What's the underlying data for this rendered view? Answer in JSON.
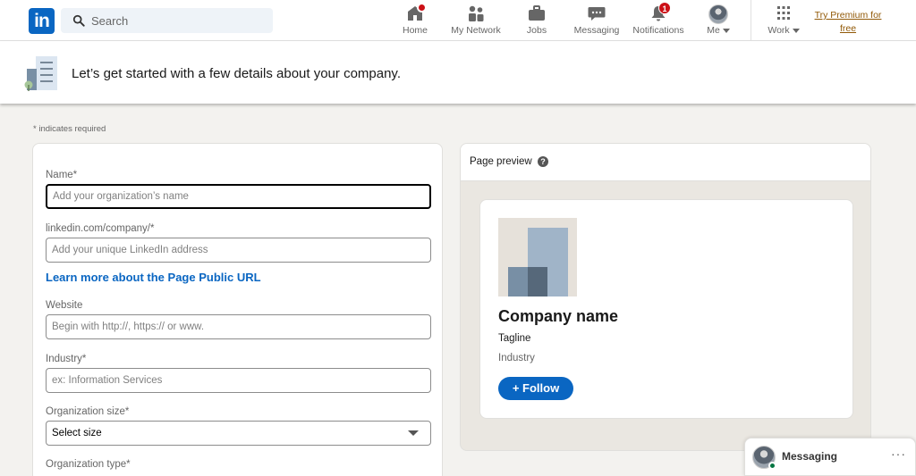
{
  "nav": {
    "logo": "in",
    "search_placeholder": "Search",
    "items": [
      {
        "label": "Home"
      },
      {
        "label": "My Network"
      },
      {
        "label": "Jobs"
      },
      {
        "label": "Messaging"
      },
      {
        "label": "Notifications",
        "badge": "1"
      },
      {
        "label": "Me"
      },
      {
        "label": "Work"
      }
    ],
    "premium_line1": "Try Premium for",
    "premium_line2": "free"
  },
  "hero": {
    "text": "Let’s get started with a few details about your company."
  },
  "form": {
    "required_note": "* indicates required",
    "name_label": "Name*",
    "name_placeholder": "Add your organization’s name",
    "url_label": "linkedin.com/company/*",
    "url_placeholder": "Add your unique LinkedIn address",
    "learn_more": "Learn more about the Page Public URL",
    "website_label": "Website",
    "website_placeholder": "Begin with http://, https:// or www.",
    "industry_label": "Industry*",
    "industry_placeholder": "ex: Information Services",
    "size_label": "Organization size*",
    "size_value": "Select size",
    "type_label": "Organization type*"
  },
  "preview": {
    "title": "Page preview",
    "help": "?",
    "company_name": "Company name",
    "tagline": "Tagline",
    "industry": "Industry",
    "follow": "+ Follow"
  },
  "messaging": {
    "label": "Messaging",
    "more": "···"
  },
  "colors": {
    "brand": "#0a66c2",
    "badge": "#cc1016",
    "premium": "#915907",
    "online": "#057642"
  }
}
